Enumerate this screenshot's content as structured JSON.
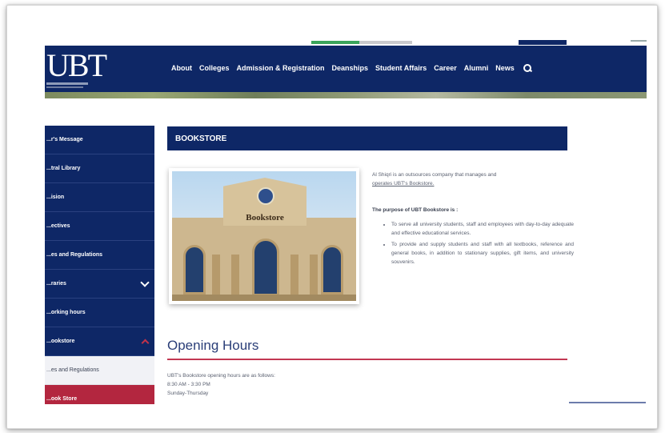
{
  "header": {
    "logo_text": "UBT",
    "nav": [
      "About",
      "Colleges",
      "Admission & Registration",
      "Deanships",
      "Student Affairs",
      "Career",
      "Alumni",
      "News"
    ]
  },
  "sidebar": {
    "items": [
      {
        "label": "...r's Message"
      },
      {
        "label": "...tral Library"
      },
      {
        "label": "...ision"
      },
      {
        "label": "...ectives"
      },
      {
        "label": "...es and Regulations"
      },
      {
        "label": "...raries"
      },
      {
        "label": "...orking hours"
      },
      {
        "label": "...ookstore"
      },
      {
        "label": "...es and Regulations"
      },
      {
        "label": "...ook Store"
      }
    ]
  },
  "main": {
    "title": "BOOKSTORE",
    "photo_sign": "Bookstore",
    "intro_line1": "Al Shiqri is an outsources company that manages and",
    "intro_line2": "operates UBT's Bookstore.",
    "purpose_heading": "The purpose of UBT Bookstore is :",
    "bullets": [
      "To serve all university students, staff and employees with day-to-day adequate and effective educational services.",
      "To provide and supply students and staff with all textbooks, reference and general books, in addition to stationary supplies, gift items, and university souvenirs."
    ],
    "opening_heading": "Opening Hours",
    "opening_text": "UBT's Bookstore opening hours are as follows:",
    "hours": "8:30 AM - 3:30 PM",
    "days": "Sunday-Thursday"
  },
  "colors": {
    "navy": "#0e2766",
    "red": "#b3263f",
    "green": "#3aa45a"
  }
}
